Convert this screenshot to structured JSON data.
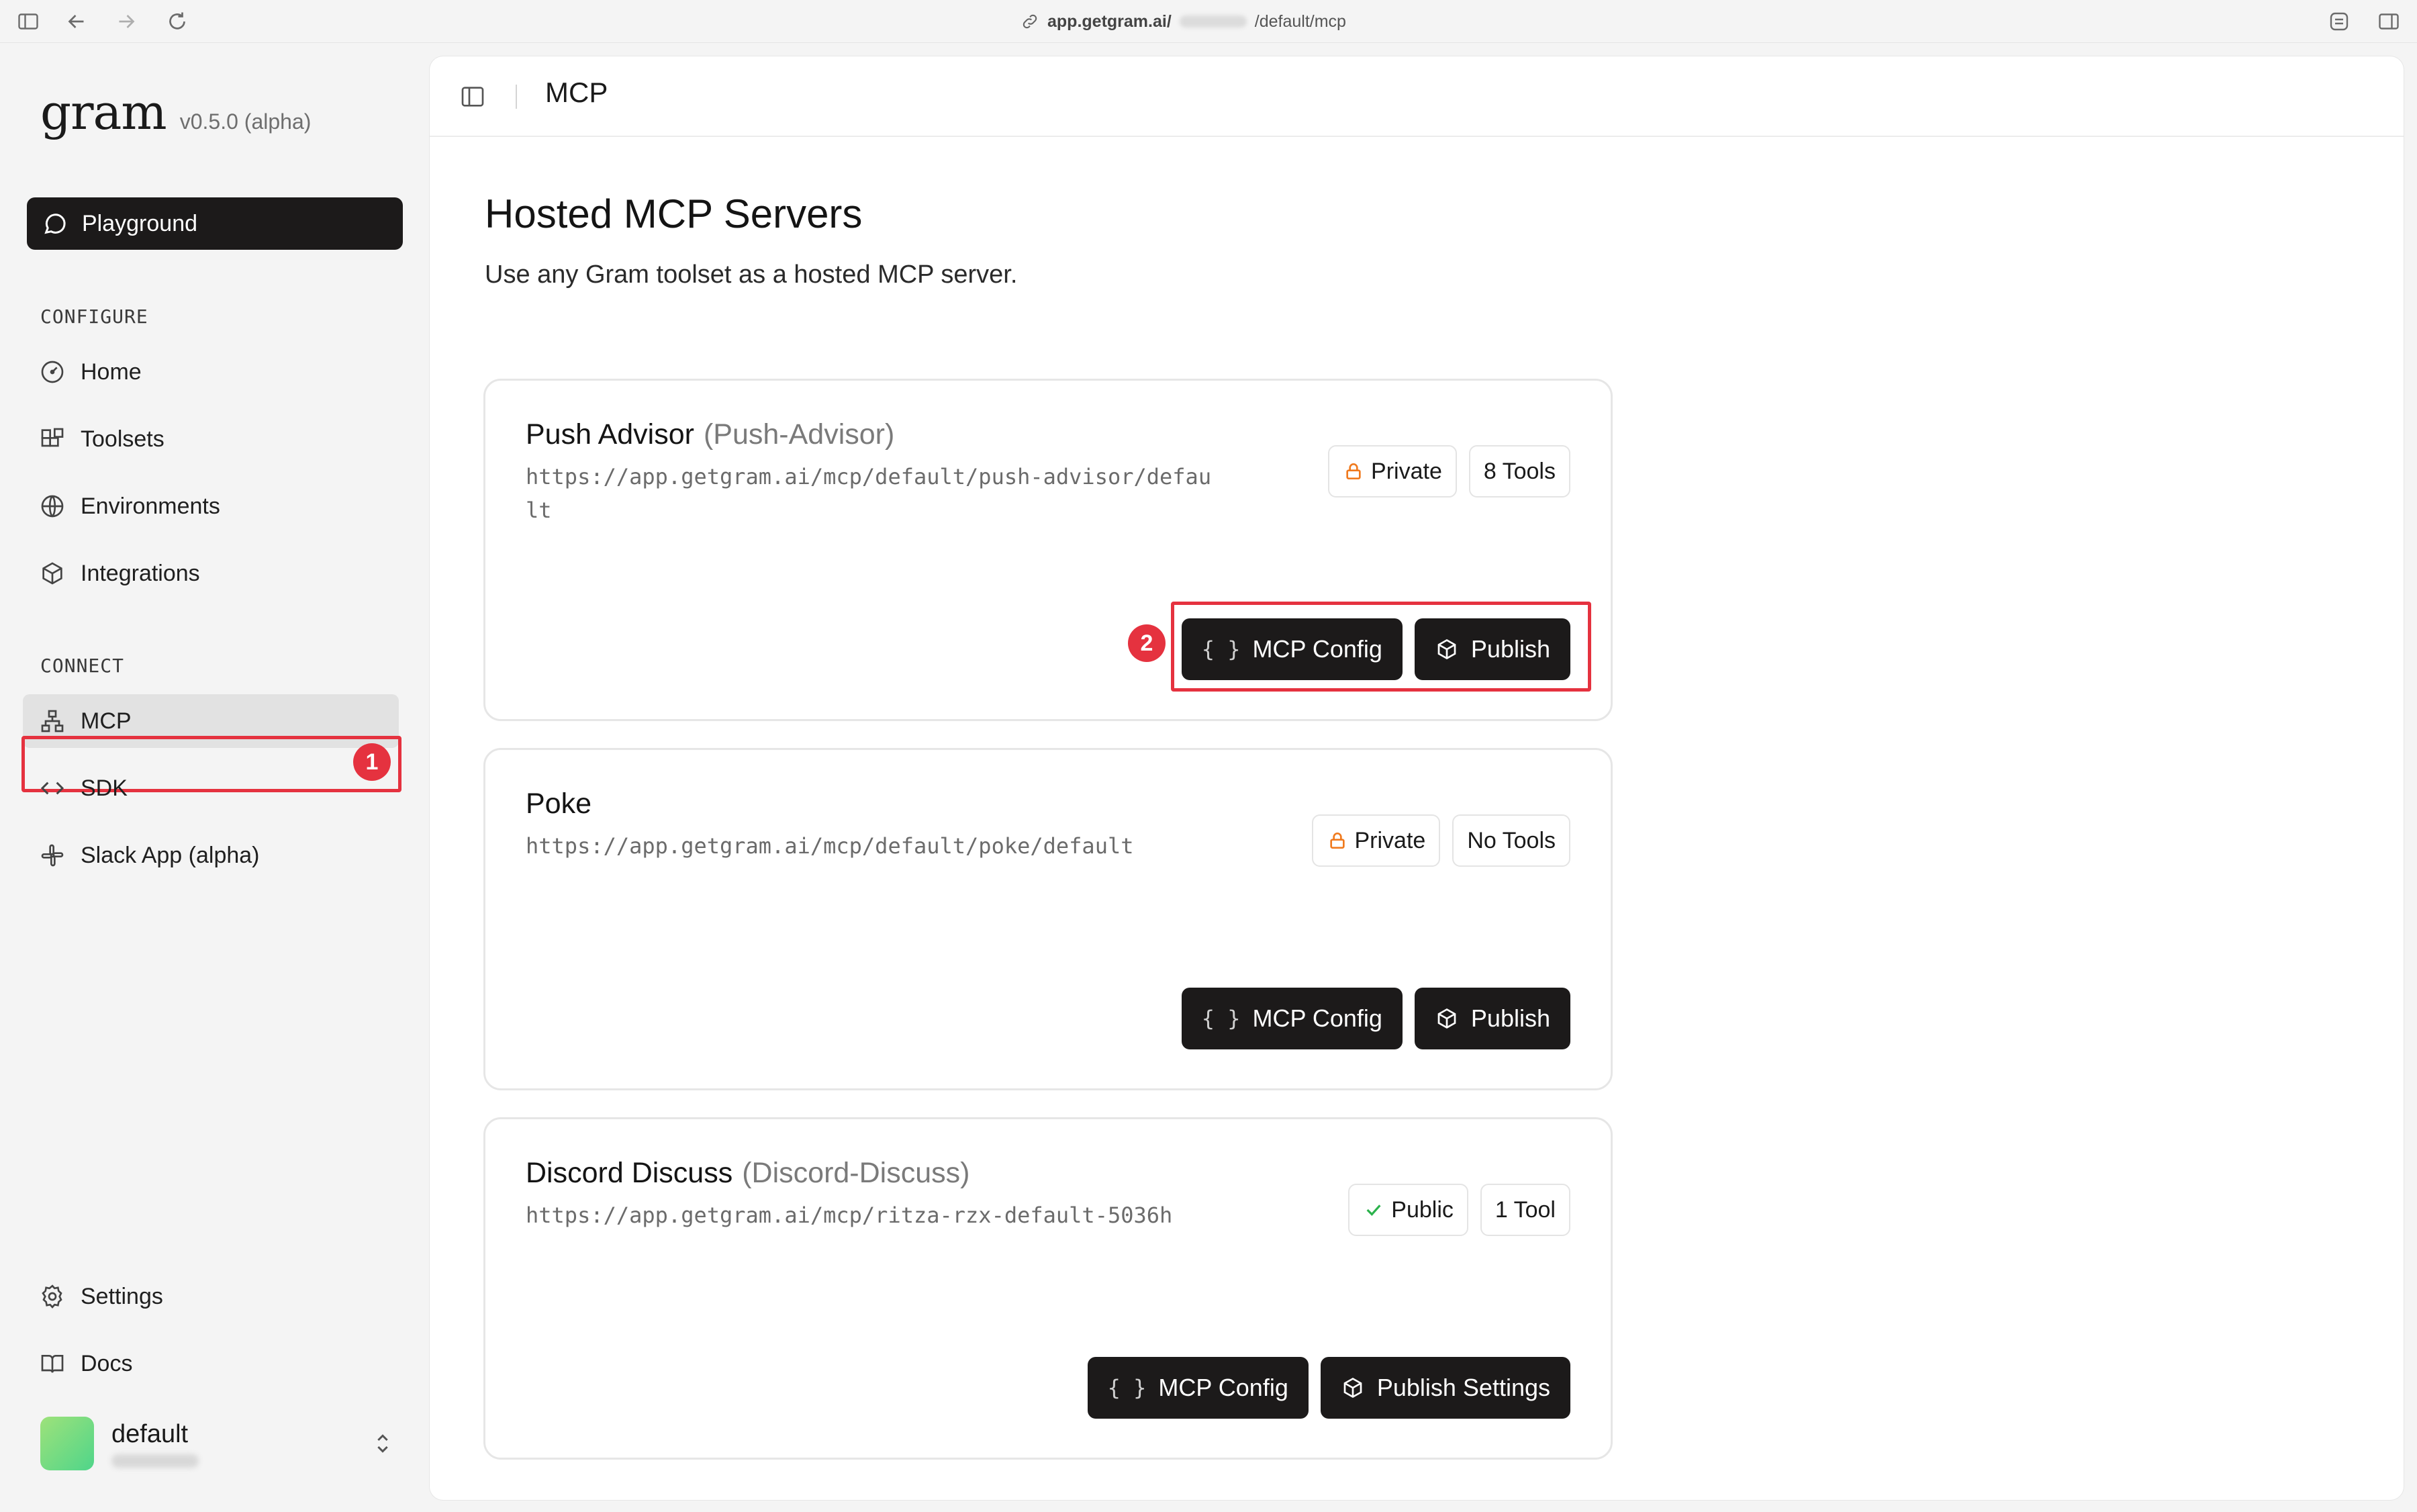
{
  "browser": {
    "url_host": "app.getgram.ai/",
    "url_path": "/default/mcp"
  },
  "sidebar": {
    "logo": "gram",
    "version": "v0.5.0 (alpha)",
    "playground_label": "Playground",
    "configure_label": "CONFIGURE",
    "configure_items": [
      {
        "label": "Home",
        "icon": "gauge-icon"
      },
      {
        "label": "Toolsets",
        "icon": "blocks-icon"
      },
      {
        "label": "Environments",
        "icon": "globe-icon"
      },
      {
        "label": "Integrations",
        "icon": "package-icon"
      }
    ],
    "connect_label": "CONNECT",
    "connect_items": [
      {
        "label": "MCP",
        "icon": "network-icon",
        "active": true
      },
      {
        "label": "SDK",
        "icon": "code-icon"
      },
      {
        "label": "Slack App (alpha)",
        "icon": "slack-icon"
      }
    ],
    "bottom_items": [
      {
        "label": "Settings",
        "icon": "gear-icon"
      },
      {
        "label": "Docs",
        "icon": "book-icon"
      }
    ],
    "account_name": "default"
  },
  "annotations": {
    "step1": "1",
    "step2": "2",
    "highlight_color": "#e5323f"
  },
  "header": {
    "title": "MCP"
  },
  "main": {
    "title": "Hosted MCP Servers",
    "subtitle": "Use any Gram toolset as a hosted MCP server."
  },
  "servers": [
    {
      "name": "Push Advisor",
      "slug": "(Push-Advisor)",
      "url": "https://app.getgram.ai/mcp/default/push-advisor/default",
      "visibility": "Private",
      "tools": "8 Tools",
      "config_label": "MCP Config",
      "publish_label": "Publish"
    },
    {
      "name": "Poke",
      "slug": "",
      "url": "https://app.getgram.ai/mcp/default/poke/default",
      "visibility": "Private",
      "tools": "No Tools",
      "config_label": "MCP Config",
      "publish_label": "Publish"
    },
    {
      "name": "Discord Discuss",
      "slug": "(Discord-Discuss)",
      "url": "https://app.getgram.ai/mcp/ritza-rzx-default-5036h",
      "visibility": "Public",
      "tools": "1 Tool",
      "config_label": "MCP Config",
      "publish_label": "Publish Settings"
    }
  ],
  "braces_glyph": "{ }",
  "colors": {
    "button_bg": "#1c1a1a",
    "private_lock": "#f07a1e",
    "public_check": "#2bb24c",
    "active_nav_bg": "#e2e2e2"
  }
}
